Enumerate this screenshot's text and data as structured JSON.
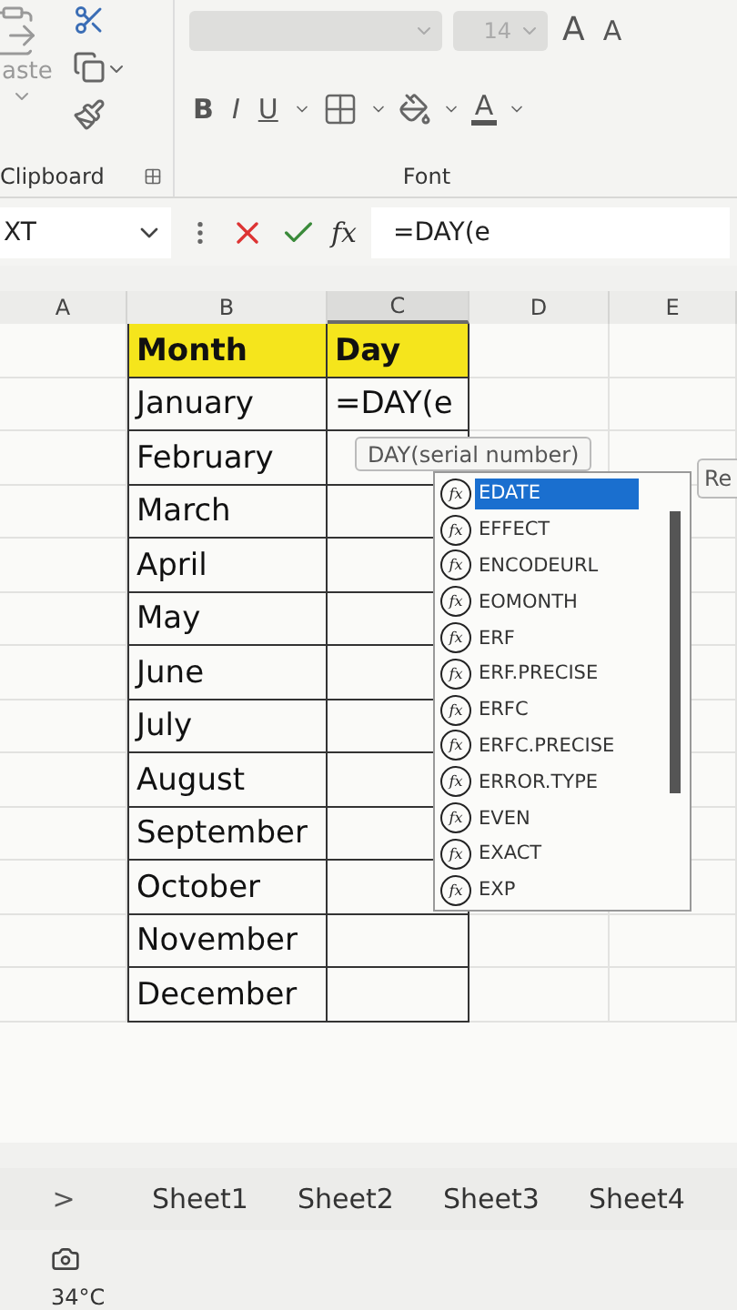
{
  "ribbon": {
    "paste_label": "aste",
    "font_size": "14",
    "grow_font": "A",
    "shrink_font": "A",
    "format_buttons": [
      "B",
      "I",
      "U"
    ],
    "font_color": "A",
    "groups": [
      "Clipboard",
      "Font"
    ]
  },
  "formula_bar": {
    "name_box": "XT",
    "function_button": "fx",
    "formula": "=DAY(e"
  },
  "columns": [
    "A",
    "B",
    "C",
    "D",
    "E"
  ],
  "table": {
    "header": [
      "Month",
      "Day"
    ],
    "rows": [
      {
        "month": "January",
        "day": "=DAY(e"
      },
      {
        "month": "February"
      },
      {
        "month": "March"
      },
      {
        "month": "April"
      },
      {
        "month": "May"
      },
      {
        "month": "June"
      },
      {
        "month": "July"
      },
      {
        "month": "August"
      },
      {
        "month": "September"
      },
      {
        "month": "October"
      },
      {
        "month": "November"
      },
      {
        "month": "December"
      }
    ]
  },
  "tooltip": "DAY(serial number)",
  "side_tip": "Re",
  "autocomplete": [
    {
      "icon": "fx",
      "label": "EDATE",
      "selected": true
    },
    {
      "icon": "fx",
      "label": "EFFECT",
      "selected": false
    },
    {
      "icon": "fx",
      "label": "ENCODEURL",
      "selected": false
    },
    {
      "icon": "fx",
      "label": "EOMONTH",
      "selected": false
    },
    {
      "icon": "fx",
      "label": "ERF",
      "selected": false
    },
    {
      "icon": "fx",
      "label": "ERF.PRECISE",
      "selected": false
    },
    {
      "icon": "fx",
      "label": "ERFC",
      "selected": false
    },
    {
      "icon": "fx",
      "label": "ERFC.PRECISE",
      "selected": false
    },
    {
      "icon": "fx",
      "label": "ERROR.TYPE",
      "selected": false
    },
    {
      "icon": "fx",
      "label": "EVEN",
      "selected": false
    },
    {
      "icon": "fx",
      "label": "EXACT",
      "selected": false
    },
    {
      "icon": "fx",
      "label": "EXP",
      "selected": false
    }
  ],
  "sheet_nav": ">",
  "sheets": [
    "Sheet1",
    "Sheet2",
    "Sheet3",
    "Sheet4"
  ],
  "taskbar": {
    "temperature": "34°C"
  }
}
